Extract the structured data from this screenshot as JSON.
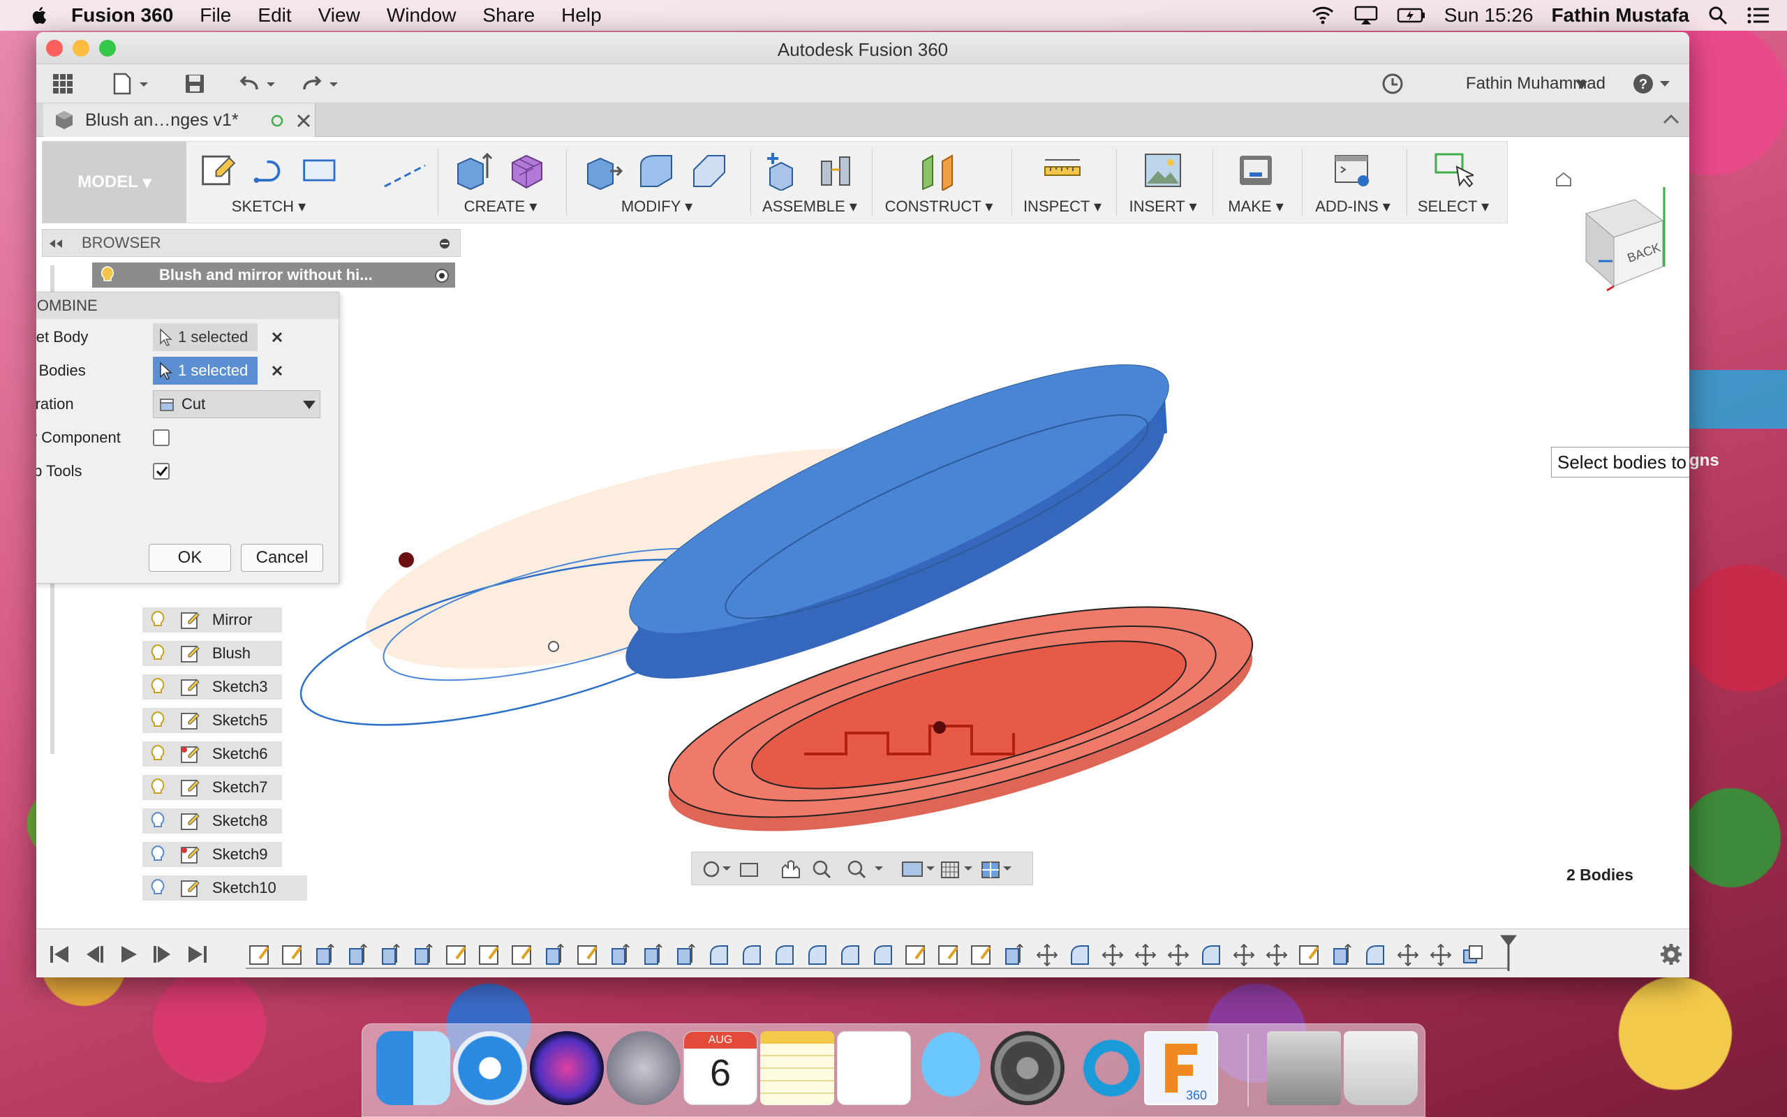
{
  "menubar": {
    "app": "Fusion 360",
    "items": [
      "File",
      "Edit",
      "View",
      "Window",
      "Share",
      "Help"
    ],
    "clock": "Sun 15:26",
    "user": "Fathin Mustafa"
  },
  "window": {
    "title": "Autodesk Fusion 360"
  },
  "qat": {
    "user": "Fathin Muhammad"
  },
  "doc_tab": {
    "label": "Blush an…nges v1*"
  },
  "toolbar": {
    "model": "MODEL",
    "groups": [
      "SKETCH",
      "CREATE",
      "MODIFY",
      "ASSEMBLE",
      "CONSTRUCT",
      "INSPECT",
      "INSERT",
      "MAKE",
      "ADD-INS",
      "SELECT"
    ]
  },
  "browser": {
    "title": "BROWSER",
    "root": "Blush and mirror without hi...",
    "items": [
      "Mirror",
      "Blush",
      "Sketch3",
      "Sketch5",
      "Sketch6",
      "Sketch7",
      "Sketch8",
      "Sketch9",
      "Sketch10"
    ]
  },
  "combine": {
    "title": "COMBINE",
    "target_label": "Target Body",
    "target_value": "1 selected",
    "tool_label": "Tool Bodies",
    "tool_value": "1 selected",
    "operation_label": "Operation",
    "operation_value": "Cut",
    "new_component_label": "New Component",
    "new_component_checked": false,
    "keep_tools_label": "Keep Tools",
    "keep_tools_checked": true,
    "ok": "OK",
    "cancel": "Cancel"
  },
  "viewcube": {
    "face": "BACK"
  },
  "tooltip": {
    "text": "Select bodies to combine w"
  },
  "status": {
    "bodies": "2 Bodies"
  },
  "background_window": {
    "text": "signs"
  },
  "dock": {
    "calendar_month": "AUG",
    "calendar_day": "6",
    "fusion_badge": "360"
  },
  "colors": {
    "accent_blue": "#3f78c8",
    "body_red": "#e8574a",
    "selected_pill": "#5b8fd2"
  }
}
